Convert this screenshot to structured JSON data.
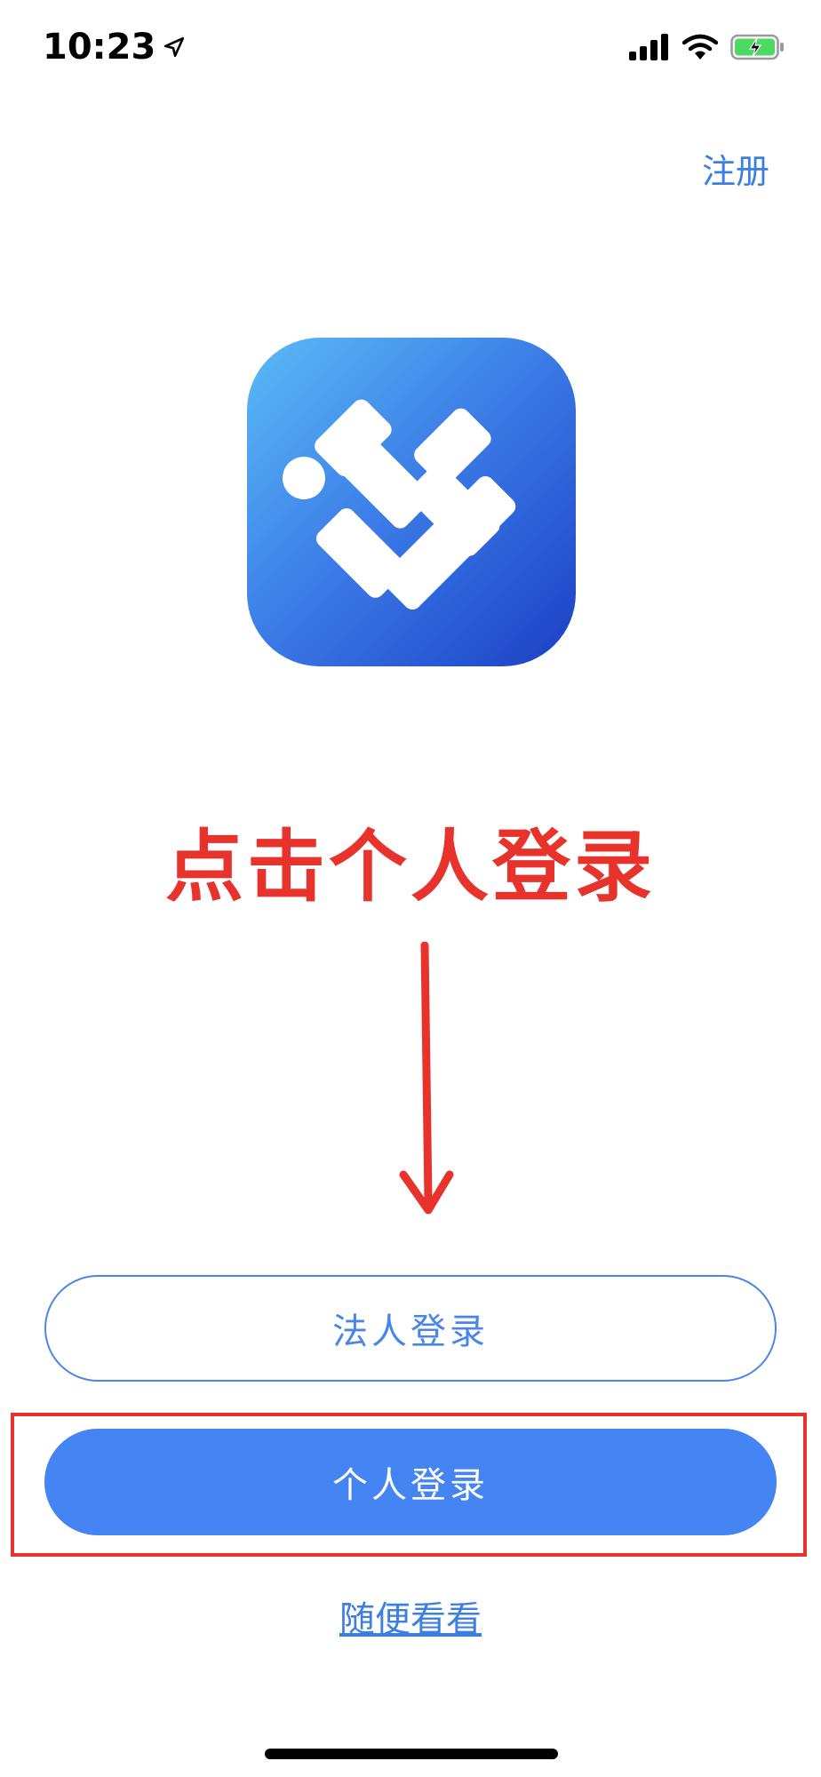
{
  "status_bar": {
    "time": "10:23",
    "icons": [
      "location-arrow-icon",
      "signal-icon",
      "wifi-icon",
      "battery-charging-icon"
    ]
  },
  "header": {
    "register_label": "注册"
  },
  "app": {
    "logo_icon": "app-logo-heart-check-icon",
    "logo_colors": [
      "#5bbcf6",
      "#3a6fe0",
      "#1c3fc4"
    ]
  },
  "annotation": {
    "instruction": "点击个人登录",
    "color": "#e8322c"
  },
  "login": {
    "legal_label": "法人登录",
    "personal_label": "个人登录",
    "browse_label": "随便看看"
  },
  "colors": {
    "accent": "#4484f3",
    "link": "#3d7fe0"
  }
}
